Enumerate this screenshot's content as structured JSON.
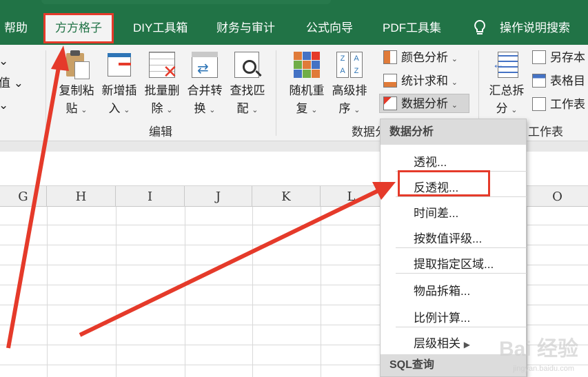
{
  "tabs": [
    "帮助",
    "方方格子",
    "DIY工具箱",
    "财务与审计",
    "公式向导",
    "PDF工具集",
    "操作说明搜索"
  ],
  "ribbon": {
    "left_partial": [
      "⌄",
      "值  ⌄",
      "⌄"
    ],
    "buttons": [
      {
        "top": "复制粘",
        "bottom": "贴"
      },
      {
        "top": "新增插",
        "bottom": "入"
      },
      {
        "top": "批量删",
        "bottom": "除"
      },
      {
        "top": "合并转",
        "bottom": "换"
      },
      {
        "top": "查找匹",
        "bottom": "配"
      },
      {
        "top": "随机重",
        "bottom": "复"
      },
      {
        "top": "高级排",
        "bottom": "序"
      },
      {
        "top": "汇总拆",
        "bottom": "分"
      }
    ],
    "small": [
      "颜色分析",
      "统计求和",
      "数据分析",
      "另存本",
      "表格目",
      "工作表"
    ],
    "groups": [
      "编辑",
      "数据分",
      "工作表"
    ]
  },
  "columns": [
    "G",
    "H",
    "I",
    "J",
    "K",
    "L",
    "O"
  ],
  "menu": {
    "header": "数据分析",
    "items": [
      "透视...",
      "反透视...",
      "时间差...",
      "按数值评级...",
      "提取指定区域...",
      "物品拆箱...",
      "比例计算...",
      "层级相关"
    ],
    "footer": "SQL查询"
  },
  "watermark": {
    "main": "Bai 经验",
    "sub": "jingyan.baidu.com"
  },
  "colors": {
    "ribbon_green": "#217346",
    "highlight": "#e53a2a"
  }
}
